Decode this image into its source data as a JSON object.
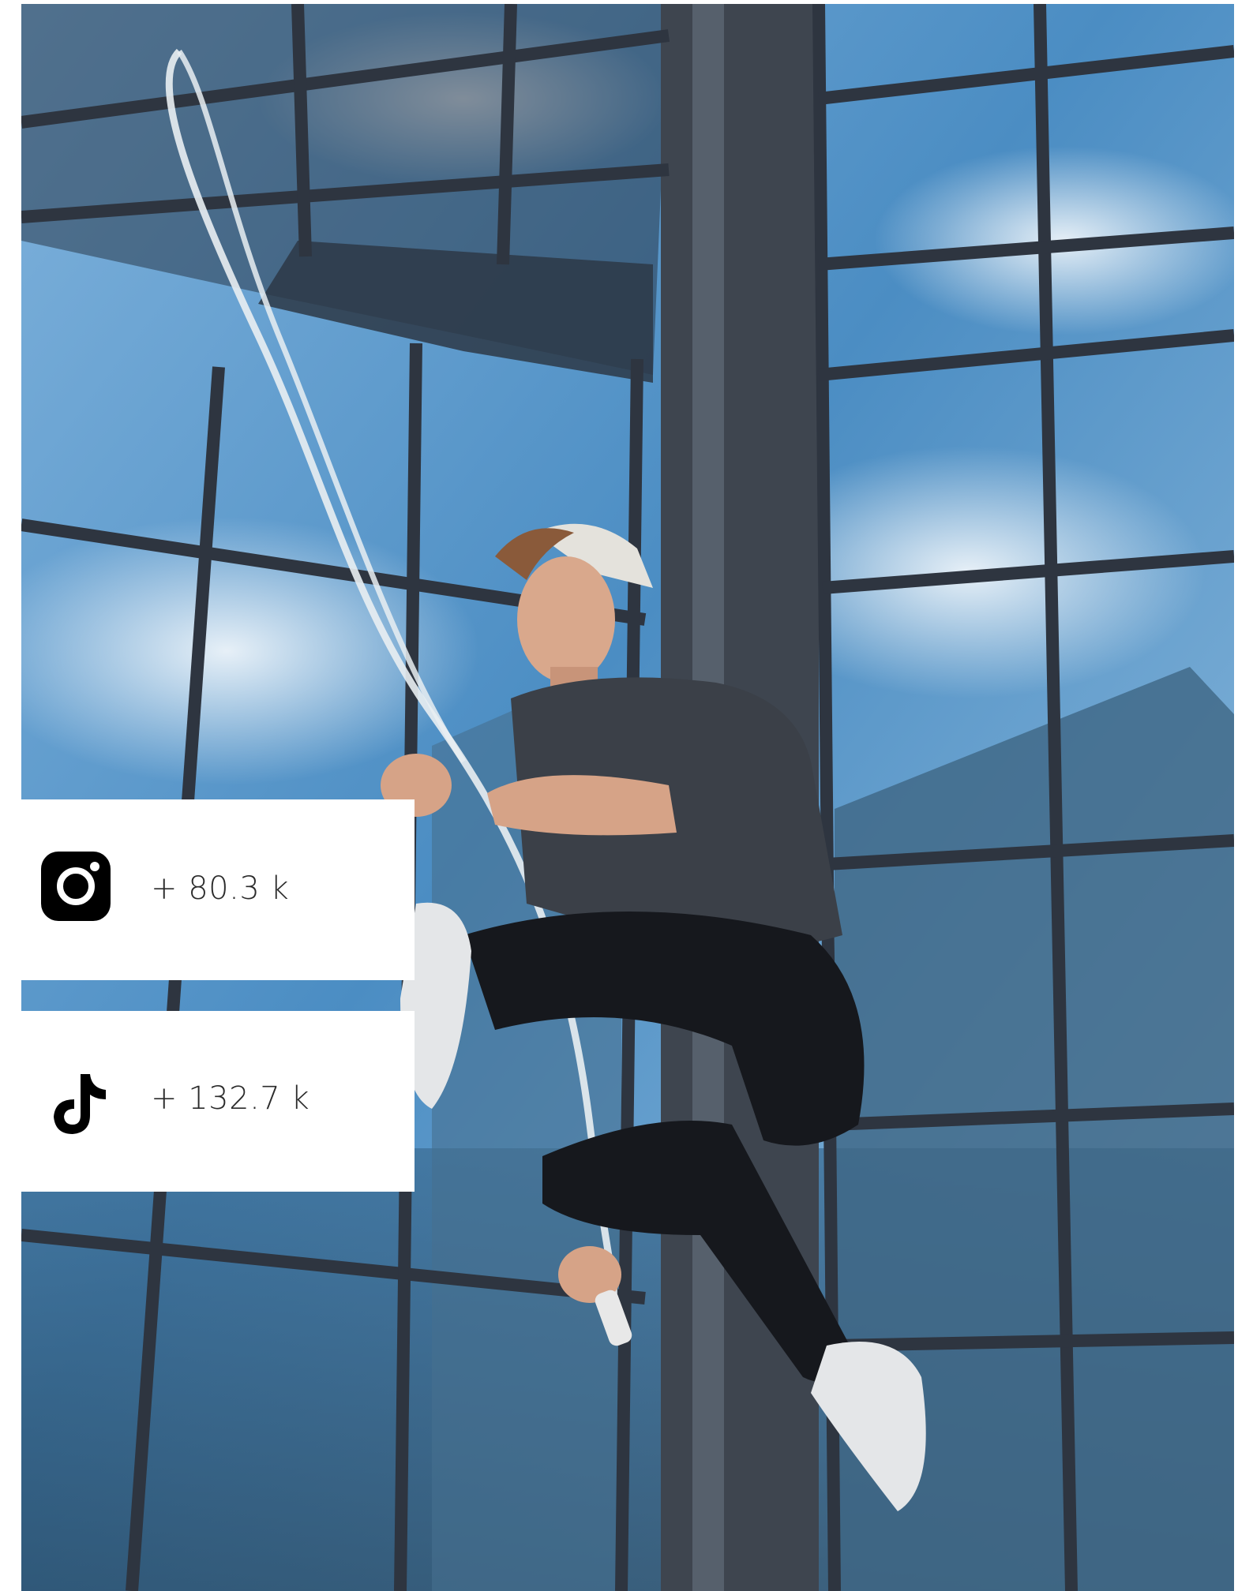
{
  "stats": [
    {
      "platform_icon": "instagram-icon",
      "value": "+ 80.3 k"
    },
    {
      "platform_icon": "tiktok-icon",
      "value": "+ 132.7 k"
    }
  ],
  "colors": {
    "card_background": "#ffffff",
    "icon": "#000000",
    "text": "#2b2b2b",
    "sky": "#4a8ec4",
    "frame": "#2e3540"
  }
}
